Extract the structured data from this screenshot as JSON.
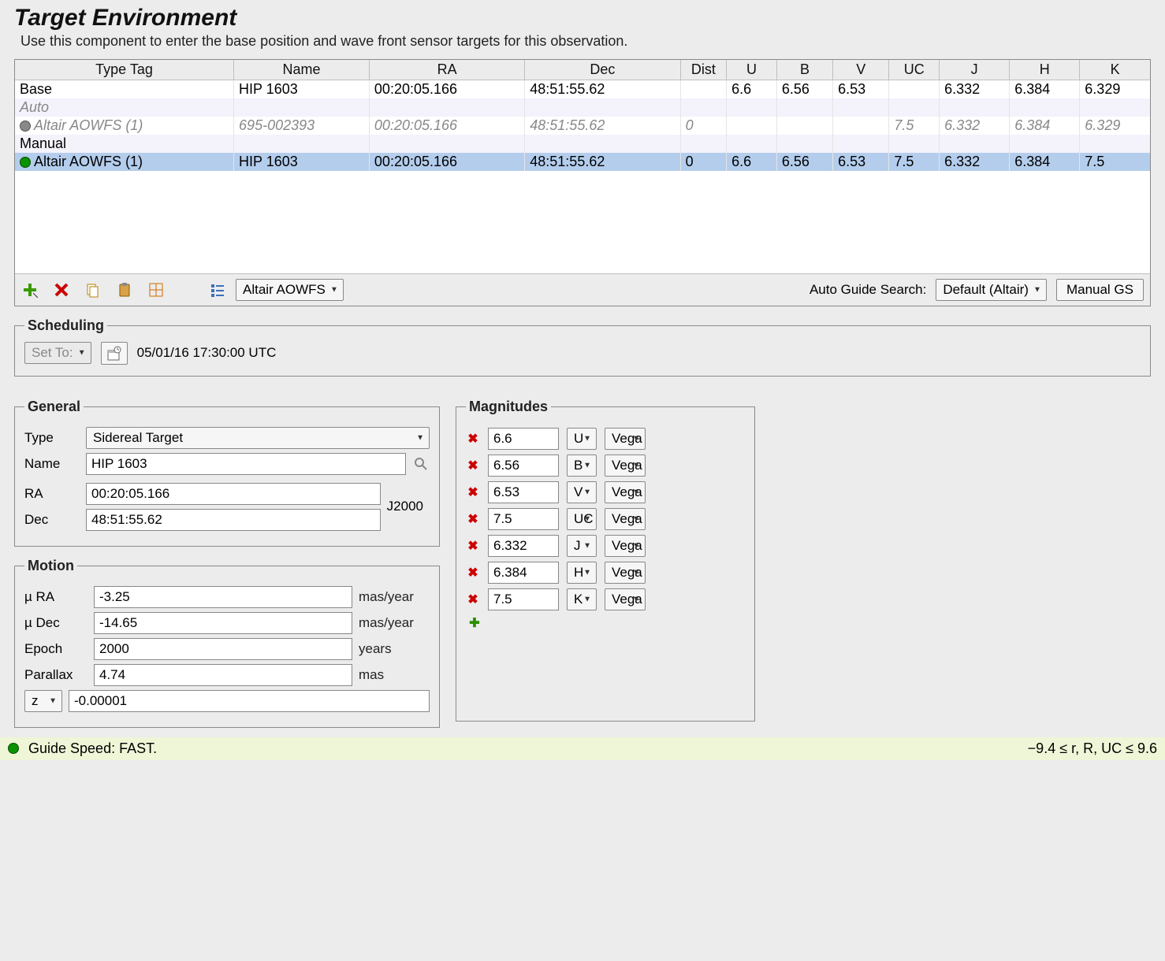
{
  "header": {
    "title": "Target Environment",
    "subtitle": "Use this component to enter the base position and wave front sensor targets for this observation."
  },
  "table": {
    "columns": [
      "Type Tag",
      "Name",
      "RA",
      "Dec",
      "Dist",
      "U",
      "B",
      "V",
      "UC",
      "J",
      "H",
      "K"
    ],
    "rows": [
      {
        "tag": "Base",
        "name": "HIP 1603",
        "ra": "00:20:05.166",
        "dec": "48:51:55.62",
        "dist": "",
        "U": "6.6",
        "B": "6.56",
        "V": "6.53",
        "UC": "",
        "J": "6.332",
        "H": "6.384",
        "K": "6.329",
        "style": "normal"
      },
      {
        "tag": "Auto",
        "style": "italic section"
      },
      {
        "tag": "Altair AOWFS (1)",
        "name": "695-002393",
        "ra": "00:20:05.166",
        "dec": "48:51:55.62",
        "dist": "0",
        "U": "",
        "B": "",
        "V": "",
        "UC": "7.5",
        "J": "6.332",
        "H": "6.384",
        "K": "6.329",
        "style": "italic indent gray-circle"
      },
      {
        "tag": "Manual",
        "style": "section"
      },
      {
        "tag": "Altair AOWFS (1)",
        "name": "HIP 1603",
        "ra": "00:20:05.166",
        "dec": "48:51:55.62",
        "dist": "0",
        "U": "6.6",
        "B": "6.56",
        "V": "6.53",
        "UC": "7.5",
        "J": "6.332",
        "H": "6.384",
        "K": "7.5",
        "style": "indent green-circle selected"
      }
    ]
  },
  "toolbar": {
    "target_type_selector": "Altair AOWFS",
    "auto_guide_label": "Auto Guide Search:",
    "auto_guide_value": "Default (Altair)",
    "manual_gs_label": "Manual GS"
  },
  "scheduling": {
    "legend": "Scheduling",
    "set_to_label": "Set To:",
    "datetime": "05/01/16 17:30:00 UTC"
  },
  "general": {
    "legend": "General",
    "type_label": "Type",
    "type_value": "Sidereal Target",
    "name_label": "Name",
    "name_value": "HIP 1603",
    "ra_label": "RA",
    "ra_value": "00:20:05.166",
    "dec_label": "Dec",
    "dec_value": "48:51:55.62",
    "epoch_label": "J2000"
  },
  "motion": {
    "legend": "Motion",
    "mu_ra_label": "µ RA",
    "mu_ra_value": "-3.25",
    "mu_ra_unit": "mas/year",
    "mu_dec_label": "µ Dec",
    "mu_dec_value": "-14.65",
    "mu_dec_unit": "mas/year",
    "epoch_label": "Epoch",
    "epoch_value": "2000",
    "epoch_unit": "years",
    "parallax_label": "Parallax",
    "parallax_value": "4.74",
    "parallax_unit": "mas",
    "rv_type": "z",
    "rv_value": "-0.00001"
  },
  "magnitudes": {
    "legend": "Magnitudes",
    "rows": [
      {
        "value": "6.6",
        "band": "U",
        "system": "Vega"
      },
      {
        "value": "6.56",
        "band": "B",
        "system": "Vega"
      },
      {
        "value": "6.53",
        "band": "V",
        "system": "Vega"
      },
      {
        "value": "7.5",
        "band": "UC",
        "system": "Vega"
      },
      {
        "value": "6.332",
        "band": "J",
        "system": "Vega"
      },
      {
        "value": "6.384",
        "band": "H",
        "system": "Vega"
      },
      {
        "value": "7.5",
        "band": "K",
        "system": "Vega"
      }
    ]
  },
  "status": {
    "text": "Guide Speed: FAST.",
    "range": "−9.4 ≤ r, R, UC ≤ 9.6"
  }
}
